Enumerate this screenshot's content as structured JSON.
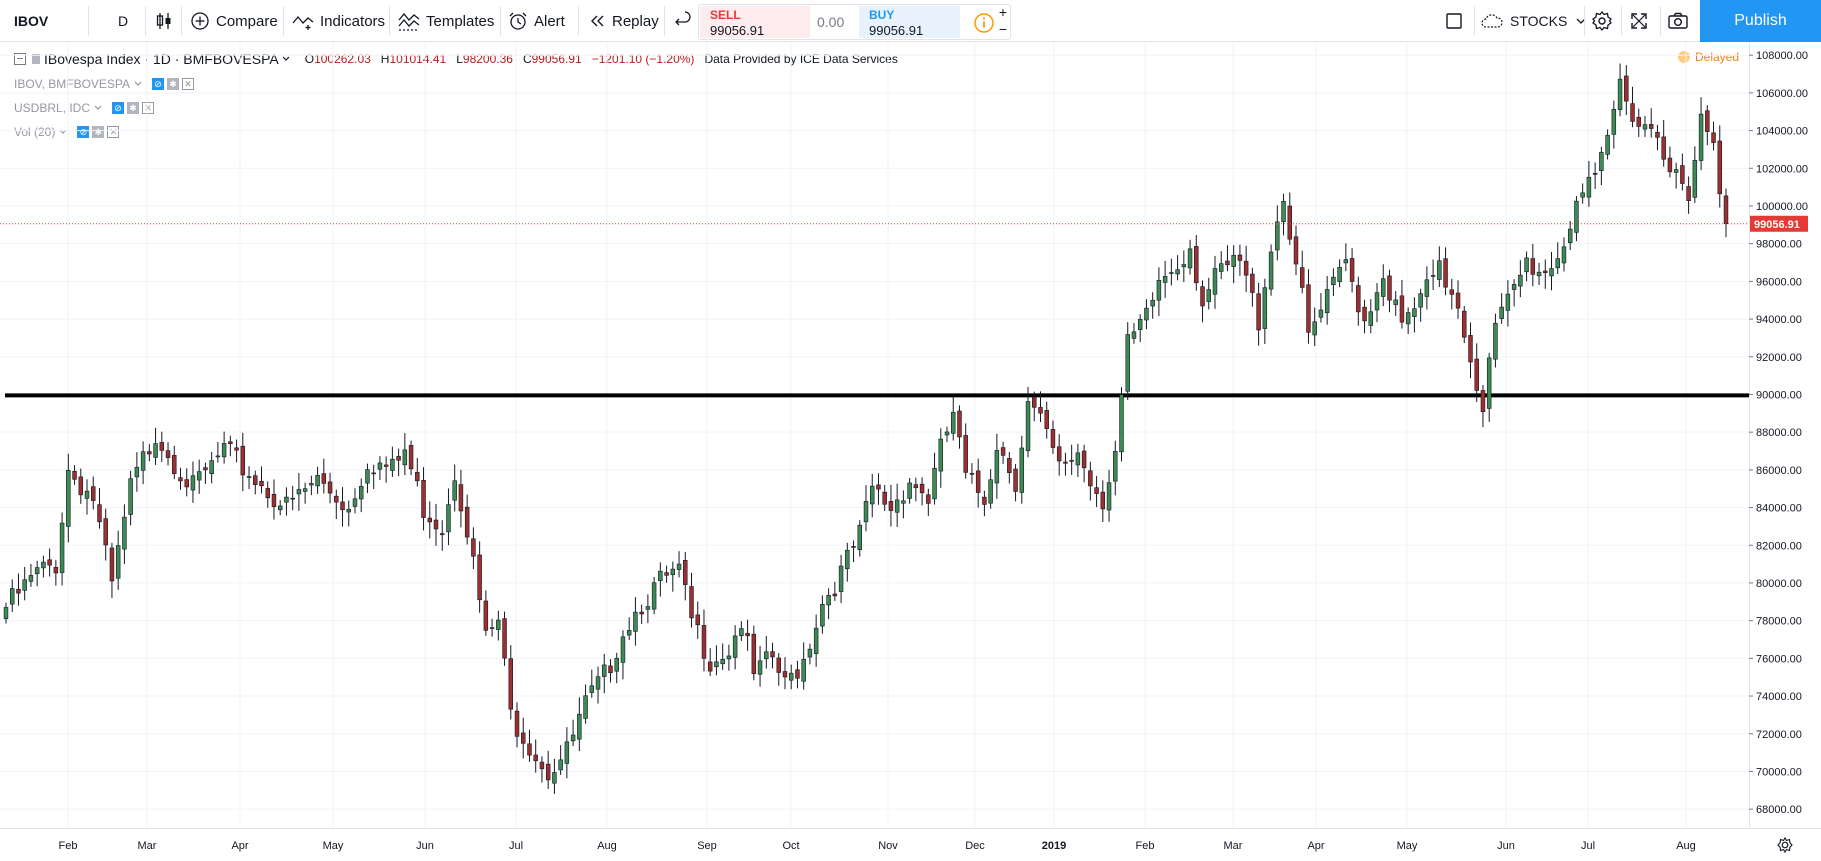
{
  "toolbar": {
    "symbol": "IBOV",
    "interval": "D",
    "compare_label": "Compare",
    "indicators_label": "Indicators",
    "templates_label": "Templates",
    "alert_label": "Alert",
    "replay_label": "Replay",
    "sell_label": "SELL",
    "sell_price": "99056.91",
    "spread": "0.00",
    "buy_label": "BUY",
    "buy_price": "99056.91",
    "plus": "+",
    "minus": "−",
    "stocks_label": "STOCKS",
    "publish_label": "Publish"
  },
  "legend": {
    "title": "IBovespa Index · 1D · BMFBOVESPA",
    "o_key": "O",
    "o_val": "100262.03",
    "h_key": "H",
    "h_val": "101014.41",
    "l_key": "L",
    "l_val": "98200.36",
    "c_key": "C",
    "c_val": "99056.91",
    "change": "−1201.10 (−1.20%)",
    "provider": "Data Provided by ICE Data Services",
    "delayed": "Delayed",
    "studies": [
      "IBOV, BMFBOVESPA",
      "USDBRL, IDC",
      "Vol (20)"
    ]
  },
  "chart_data": {
    "type": "candlestick",
    "y_ticks": [
      "108000.00",
      "106000.00",
      "104000.00",
      "102000.00",
      "100000.00",
      "98000.00",
      "96000.00",
      "94000.00",
      "92000.00",
      "90000.00",
      "88000.00",
      "86000.00",
      "84000.00",
      "82000.00",
      "80000.00",
      "78000.00",
      "76000.00",
      "74000.00",
      "72000.00",
      "70000.00",
      "68000.00"
    ],
    "ylim": [
      67000,
      108700
    ],
    "x_ticks": [
      "Feb",
      "Mar",
      "Apr",
      "May",
      "Jun",
      "Jul",
      "Aug",
      "Sep",
      "Oct",
      "Nov",
      "Dec",
      "2019",
      "Feb",
      "Mar",
      "Apr",
      "May",
      "Jun",
      "Jul",
      "Aug"
    ],
    "last_price": 99056.91,
    "last_price_label": "99056.91",
    "horizontal_line": 89950,
    "colors": {
      "up": "#3d8b52",
      "down": "#9c2f2f",
      "grid": "#f0f3fa",
      "price_line": "#e53935",
      "drawn_line": "#000000"
    },
    "path_points": [
      [
        0,
        78700
      ],
      [
        5,
        80500
      ],
      [
        8,
        81000
      ],
      [
        10,
        86000
      ],
      [
        14,
        84500
      ],
      [
        17,
        79800
      ],
      [
        20,
        85000
      ],
      [
        24,
        88000
      ],
      [
        30,
        85000
      ],
      [
        35,
        87000
      ],
      [
        40,
        85500
      ],
      [
        45,
        84000
      ],
      [
        50,
        85500
      ],
      [
        55,
        84000
      ],
      [
        58,
        86500
      ],
      [
        62,
        86000
      ],
      [
        64,
        87000
      ],
      [
        67,
        84000
      ],
      [
        70,
        83000
      ],
      [
        72,
        86000
      ],
      [
        74,
        83000
      ],
      [
        77,
        77000
      ],
      [
        79,
        78000
      ],
      [
        81,
        73000
      ],
      [
        84,
        71500
      ],
      [
        87,
        70000
      ],
      [
        90,
        71000
      ],
      [
        93,
        73500
      ],
      [
        96,
        75000
      ],
      [
        99,
        77500
      ],
      [
        102,
        79000
      ],
      [
        105,
        80000
      ],
      [
        108,
        80500
      ],
      [
        110,
        78000
      ],
      [
        113,
        76000
      ],
      [
        116,
        76500
      ],
      [
        118,
        78000
      ],
      [
        120,
        75000
      ],
      [
        123,
        76000
      ],
      [
        125,
        74500
      ],
      [
        128,
        76000
      ],
      [
        131,
        79000
      ],
      [
        134,
        80500
      ],
      [
        137,
        82500
      ],
      [
        139,
        85000
      ],
      [
        142,
        84000
      ],
      [
        145,
        85500
      ],
      [
        148,
        84500
      ],
      [
        150,
        87000
      ],
      [
        152,
        89000
      ],
      [
        154,
        85500
      ],
      [
        157,
        84500
      ],
      [
        159,
        87500
      ],
      [
        162,
        85500
      ],
      [
        164,
        89500
      ],
      [
        166,
        88500
      ],
      [
        169,
        86000
      ],
      [
        172,
        87000
      ],
      [
        174,
        85500
      ],
      [
        176,
        84500
      ],
      [
        178,
        87000
      ],
      [
        180,
        92500
      ],
      [
        183,
        94000
      ],
      [
        185,
        96000
      ],
      [
        188,
        97000
      ],
      [
        190,
        98000
      ],
      [
        192,
        95000
      ],
      [
        195,
        96500
      ],
      [
        198,
        97000
      ],
      [
        201,
        94000
      ],
      [
        203,
        98000
      ],
      [
        205,
        100500
      ],
      [
        207,
        97000
      ],
      [
        209,
        93000
      ],
      [
        212,
        95000
      ],
      [
        215,
        97000
      ],
      [
        218,
        94000
      ],
      [
        221,
        96500
      ],
      [
        224,
        93500
      ],
      [
        227,
        95000
      ],
      [
        230,
        96500
      ],
      [
        233,
        95000
      ],
      [
        235,
        92000
      ],
      [
        237,
        89500
      ],
      [
        239,
        93500
      ],
      [
        242,
        95500
      ],
      [
        244,
        97000
      ],
      [
        247,
        96500
      ],
      [
        250,
        98000
      ],
      [
        252,
        100500
      ],
      [
        255,
        101000
      ],
      [
        257,
        103500
      ],
      [
        259,
        106500
      ],
      [
        262,
        104500
      ],
      [
        265,
        104000
      ],
      [
        268,
        101500
      ],
      [
        270,
        100000
      ],
      [
        272,
        104500
      ],
      [
        274,
        103000
      ],
      [
        276,
        99000
      ]
    ]
  }
}
